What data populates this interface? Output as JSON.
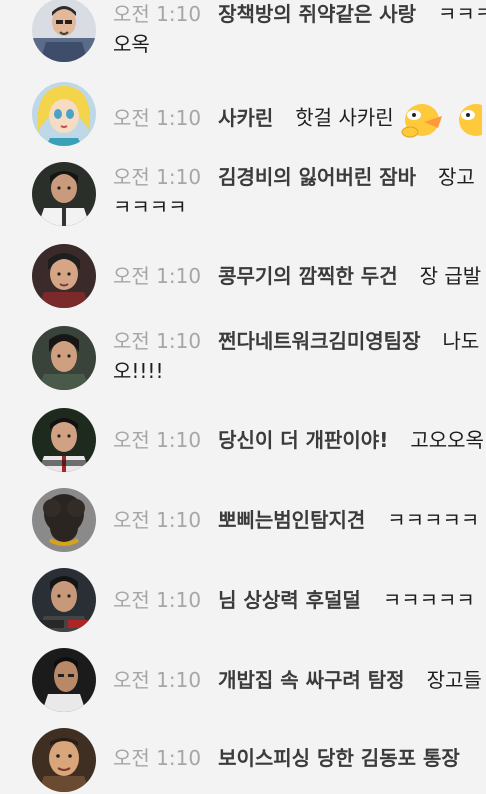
{
  "messages": [
    {
      "time": "오전 1:10",
      "nickname": "장책방의 쥐약같은 사랑",
      "text": "ㅋㅋㅋㅋㅋ",
      "continuation": "오옥"
    },
    {
      "time": "오전 1:10",
      "nickname": "사카린",
      "text": "핫걸 사카린",
      "continuation": ""
    },
    {
      "time": "오전 1:10",
      "nickname": "김경비의 잃어버린 잠바",
      "text": "장고",
      "continuation": "ㅋㅋㅋㅋ"
    },
    {
      "time": "오전 1:10",
      "nickname": "콩무기의 깜찍한 두건",
      "text": "장 급발",
      "continuation": ""
    },
    {
      "time": "오전 1:10",
      "nickname": "쩐다네트워크김미영팀장",
      "text": "나도",
      "continuation": "오!!!!"
    },
    {
      "time": "오전 1:10",
      "nickname": "당신이 더 개판이야!",
      "text": "고오오옥",
      "continuation": ""
    },
    {
      "time": "오전 1:10",
      "nickname": "뽀삐는범인탐지견",
      "text": "ㅋㅋㅋㅋㅋ",
      "continuation": ""
    },
    {
      "time": "오전 1:10",
      "nickname": "님 상상력 후덜덜",
      "text": "ㅋㅋㅋㅋㅋ",
      "continuation": ""
    },
    {
      "time": "오전 1:10",
      "nickname": "개밥집 속 싸구려 탐정",
      "text": "장고들",
      "continuation": ""
    },
    {
      "time": "오전 1:10",
      "nickname": "보이스피싱 당한 김동포 통장",
      "text": "",
      "continuation": ""
    }
  ],
  "colors": {
    "background": "#f3f3f3",
    "time": "#a6a6a6",
    "nickname": "#3b3b3b",
    "text": "#1e1e1e",
    "emoticon": "#ffc93c"
  },
  "icons": {
    "emoticon": "yellow-bird-emoticon-icon"
  }
}
